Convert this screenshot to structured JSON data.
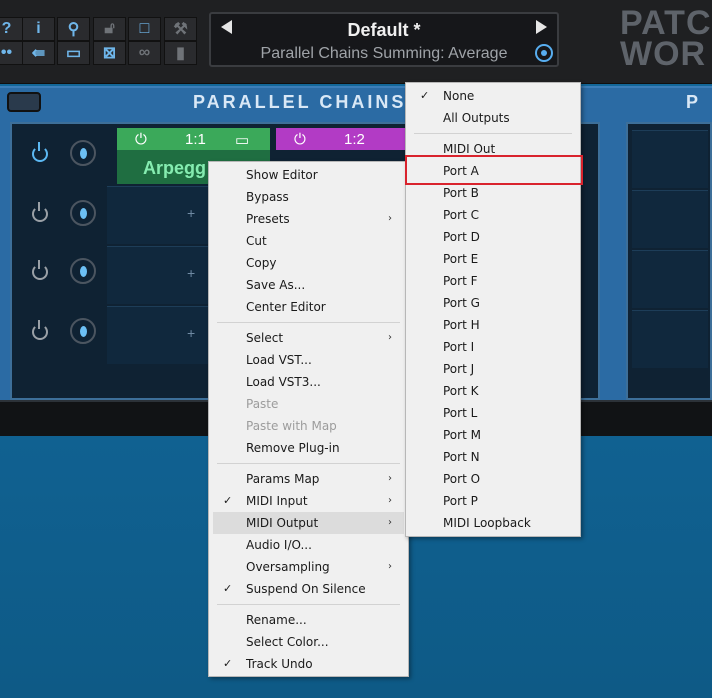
{
  "toolbar": {
    "icons": [
      "help-icon",
      "info-icon",
      "zoom-icon",
      "lock-icon",
      "window-icon",
      "wrench-icon",
      "midi-icon",
      "input-icon",
      "editor-icon",
      "close-window-icon",
      "link-icon",
      "meter-icon"
    ]
  },
  "preset": {
    "name": "Default *",
    "subtitle": "Parallel Chains Summing: Average"
  },
  "logo": "PATC\nWOR",
  "chain_panel": {
    "title": "PARALLEL CHAINS",
    "title_right": "P",
    "slot1": {
      "index": "1:1",
      "name": "Arpegg"
    },
    "slot2": {
      "index": "1:2"
    }
  },
  "context_menu": {
    "items": [
      {
        "label": "Show Editor"
      },
      {
        "label": "Bypass"
      },
      {
        "label": "Presets",
        "submenu": true
      },
      {
        "label": "Cut"
      },
      {
        "label": "Copy"
      },
      {
        "label": "Save As..."
      },
      {
        "label": "Center Editor"
      },
      {
        "label": "Select",
        "submenu": true
      },
      {
        "label": "Load VST..."
      },
      {
        "label": "Load VST3..."
      },
      {
        "label": "Paste",
        "disabled": true
      },
      {
        "label": "Paste with Map",
        "disabled": true
      },
      {
        "label": "Remove Plug-in"
      },
      {
        "label": "Params Map",
        "submenu": true
      },
      {
        "label": "MIDI Input",
        "submenu": true,
        "checked": true
      },
      {
        "label": "MIDI Output",
        "submenu": true,
        "active": true
      },
      {
        "label": "Audio I/O..."
      },
      {
        "label": "Oversampling",
        "submenu": true
      },
      {
        "label": "Suspend On Silence",
        "checked": true
      },
      {
        "label": "Rename..."
      },
      {
        "label": "Select Color..."
      },
      {
        "label": "Track Undo",
        "checked": true
      }
    ],
    "checkmark": "✓",
    "submenu_arrow": "›"
  },
  "midi_output_menu": {
    "items": [
      {
        "label": "None",
        "checked": true
      },
      {
        "label": "All Outputs"
      },
      {
        "label": "MIDI Out"
      },
      {
        "label": "Port A",
        "highlighted": true
      },
      {
        "label": "Port B"
      },
      {
        "label": "Port C"
      },
      {
        "label": "Port D"
      },
      {
        "label": "Port E"
      },
      {
        "label": "Port F"
      },
      {
        "label": "Port G"
      },
      {
        "label": "Port H"
      },
      {
        "label": "Port I"
      },
      {
        "label": "Port J"
      },
      {
        "label": "Port K"
      },
      {
        "label": "Port L"
      },
      {
        "label": "Port M"
      },
      {
        "label": "Port N"
      },
      {
        "label": "Port O"
      },
      {
        "label": "Port P"
      },
      {
        "label": "MIDI Loopback"
      }
    ]
  },
  "colors": {
    "accent": "#5cb8f2",
    "slot1": "#3ba95a",
    "slot2": "#b23bc5",
    "highlight_border": "#d9232d"
  }
}
